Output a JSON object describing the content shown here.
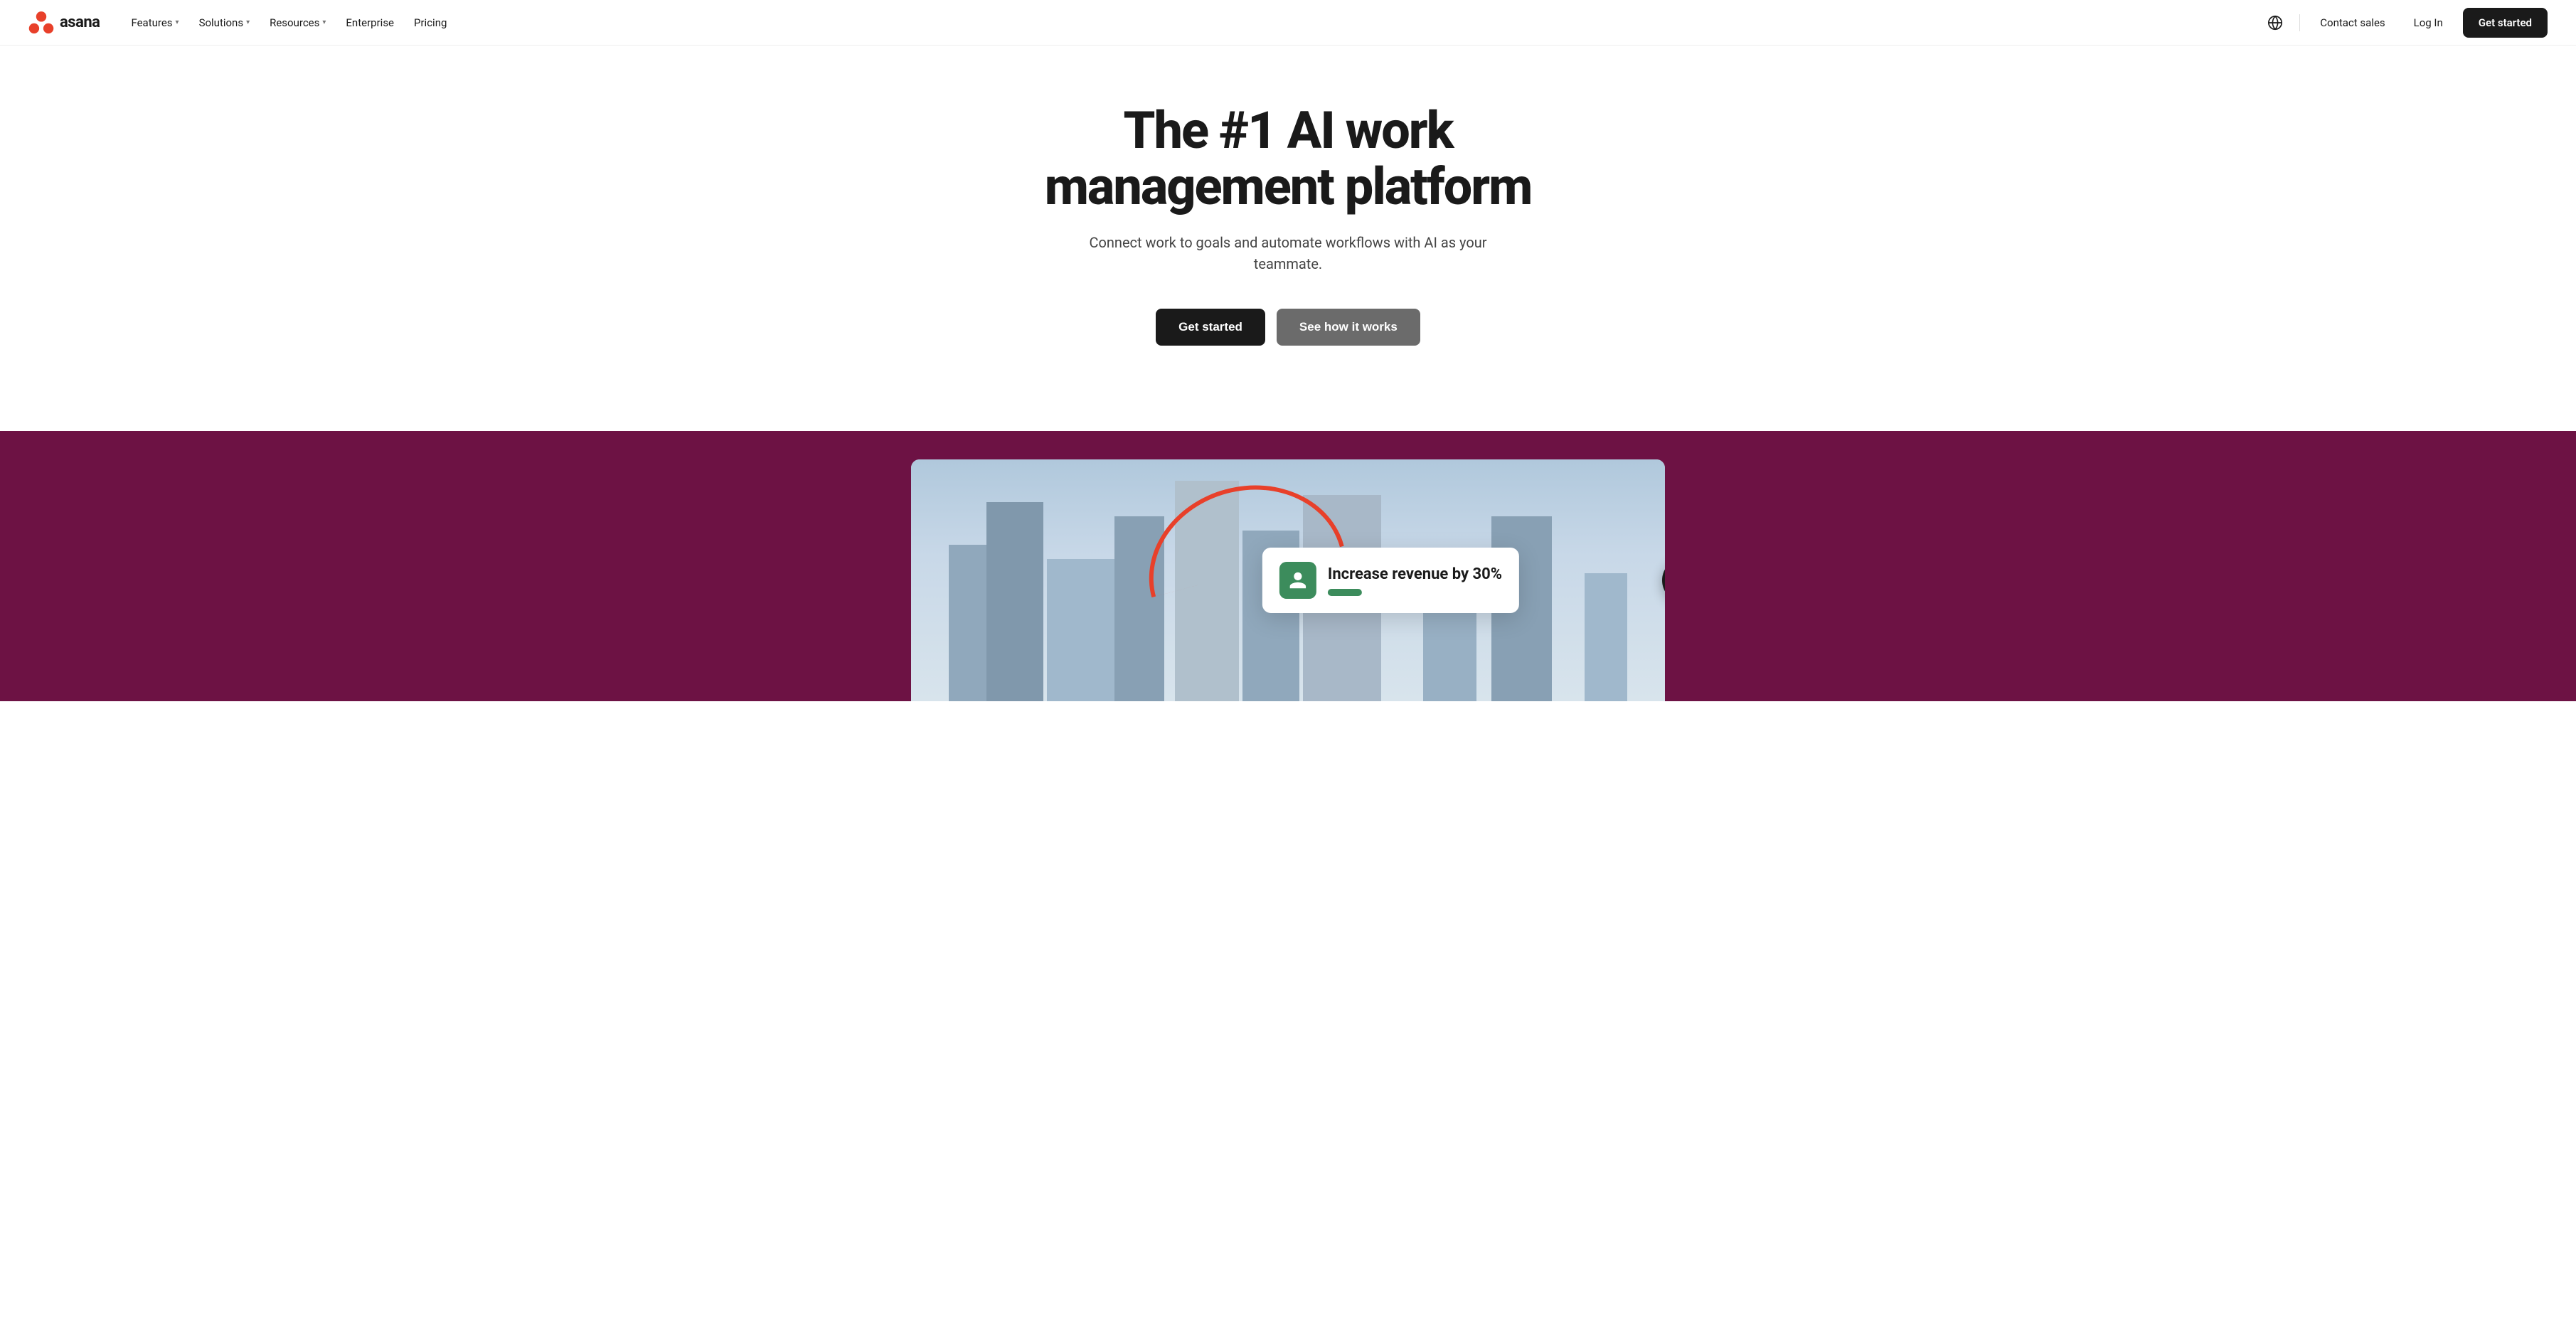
{
  "nav": {
    "logo_text": "asana",
    "links": [
      {
        "label": "Features",
        "has_dropdown": true
      },
      {
        "label": "Solutions",
        "has_dropdown": true
      },
      {
        "label": "Resources",
        "has_dropdown": true
      },
      {
        "label": "Enterprise",
        "has_dropdown": false
      },
      {
        "label": "Pricing",
        "has_dropdown": false
      }
    ],
    "contact_sales": "Contact sales",
    "login": "Log In",
    "get_started": "Get started"
  },
  "hero": {
    "title": "The #1 AI work management platform",
    "subtitle": "Connect work to goals and automate workflows with AI as your teammate.",
    "btn_primary": "Get started",
    "btn_secondary": "See how it works"
  },
  "video": {
    "notification_text": "Increase revenue by 30%",
    "sound_icon": "sound-icon"
  }
}
